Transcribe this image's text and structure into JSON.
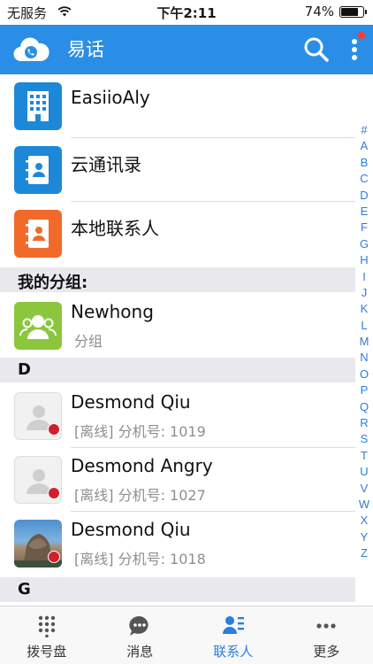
{
  "status_bar": {
    "carrier": "无服务",
    "time": "下午2:11",
    "battery_percent": "74%",
    "battery_level": 0.74
  },
  "header": {
    "title": "易话",
    "accent_color": "#2b8ee6",
    "search_icon": "search-icon",
    "more_icon": "more-vertical-icon"
  },
  "entries": [
    {
      "name": "EasiioAly",
      "icon": "building-icon"
    },
    {
      "name": "云通讯录",
      "icon": "address-book-icon"
    },
    {
      "name": "本地联系人",
      "icon": "address-book-icon"
    }
  ],
  "group_section": {
    "label": "我的分组:",
    "groups": [
      {
        "name": "Newhong",
        "sub": "分组",
        "icon": "group-icon"
      }
    ]
  },
  "sections": [
    {
      "letter": "D",
      "contacts": [
        {
          "name": "Desmond Qiu",
          "status": "[离线] 分机号: 1019",
          "avatar": "default-person-icon"
        },
        {
          "name": "Desmond Angry",
          "status": "[离线] 分机号: 1027",
          "avatar": "default-person-icon"
        },
        {
          "name": "Desmond Qiu",
          "status": "[离线] 分机号: 1018",
          "avatar": "photo-avatar"
        }
      ]
    },
    {
      "letter": "G",
      "contacts": []
    }
  ],
  "index_letters": [
    "#",
    "A",
    "B",
    "C",
    "D",
    "E",
    "F",
    "G",
    "H",
    "I",
    "J",
    "K",
    "L",
    "M",
    "N",
    "O",
    "P",
    "Q",
    "R",
    "S",
    "T",
    "U",
    "V",
    "W",
    "X",
    "Y",
    "Z"
  ],
  "tabs": [
    {
      "label": "拨号盘",
      "icon": "dialpad-icon",
      "active": false
    },
    {
      "label": "消息",
      "icon": "message-icon",
      "active": false
    },
    {
      "label": "联系人",
      "icon": "contacts-icon",
      "active": true
    },
    {
      "label": "更多",
      "icon": "more-horizontal-icon",
      "active": false
    }
  ],
  "colors": {
    "accent": "#2b8ee6",
    "active_tab": "#2b7de0",
    "offline": "#d0202a",
    "section_bg": "#e9e9ed"
  }
}
